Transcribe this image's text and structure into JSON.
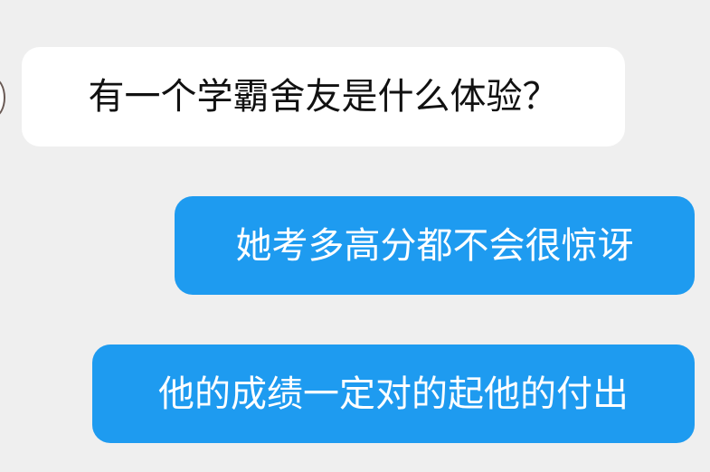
{
  "chat": {
    "messages": [
      {
        "sender": "other",
        "text": "有一个学霸舍友是什么体验？"
      },
      {
        "sender": "me",
        "text": "她考多高分都不会很惊讶"
      },
      {
        "sender": "me",
        "text": "他的成绩一定对的起他的付出"
      }
    ]
  },
  "colors": {
    "background": "#efefef",
    "incoming_bubble": "#ffffff",
    "outgoing_bubble": "#1e9bf0"
  }
}
